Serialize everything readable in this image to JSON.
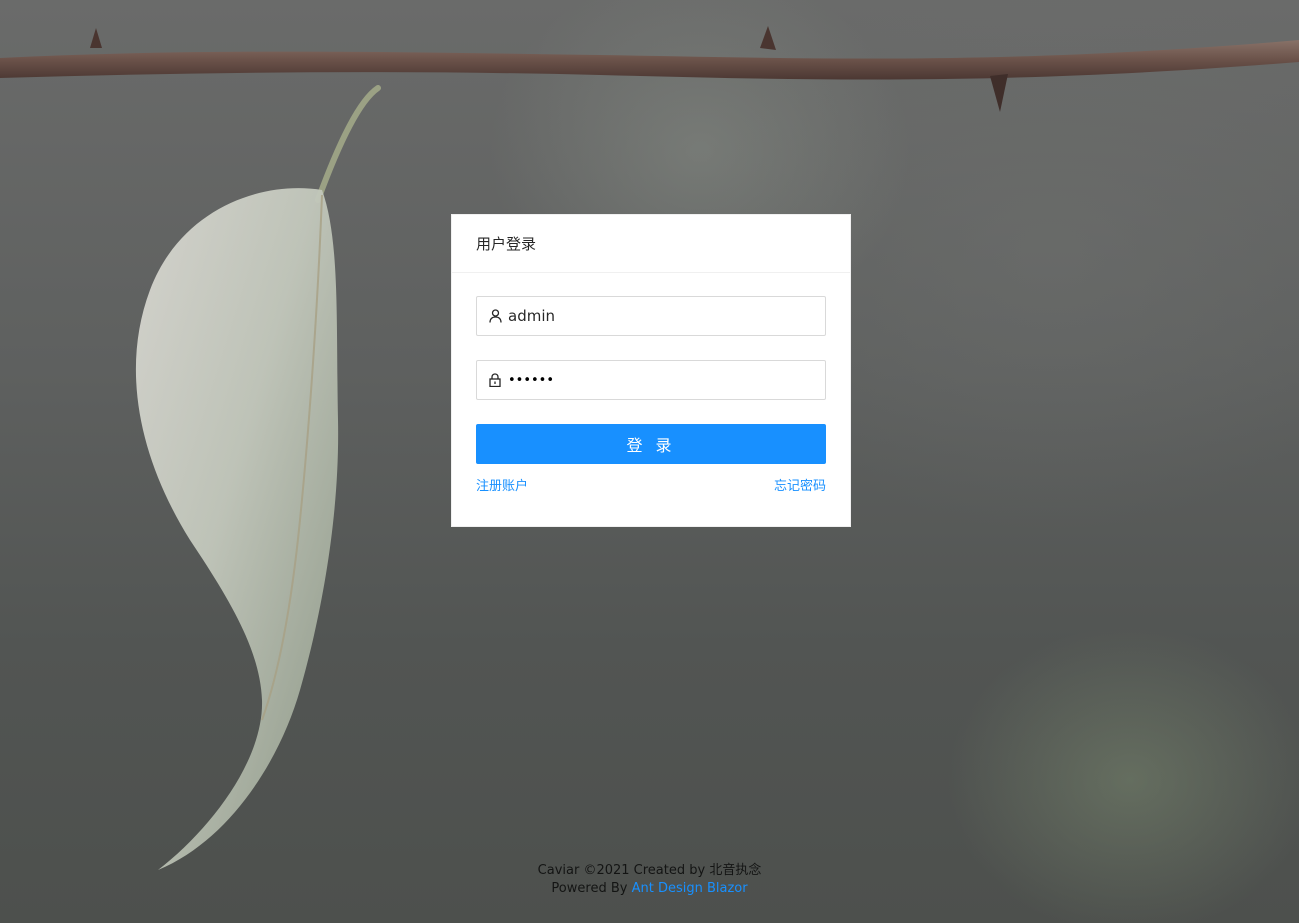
{
  "login": {
    "title": "用户登录",
    "username_value": "admin",
    "password_display": "••••••",
    "submit_label": "登 录",
    "register_link": "注册账户",
    "forgot_link": "忘记密码"
  },
  "footer": {
    "copyright": "Caviar ©2021 Created by 北音执念",
    "powered_prefix": "Powered By",
    "powered_link": "Ant Design Blazor"
  },
  "icons": {
    "username": "user-icon",
    "password": "lock-icon"
  },
  "colors": {
    "primary": "#1890ff",
    "card_background": "#ffffff",
    "input_border": "#d9d9d9"
  }
}
